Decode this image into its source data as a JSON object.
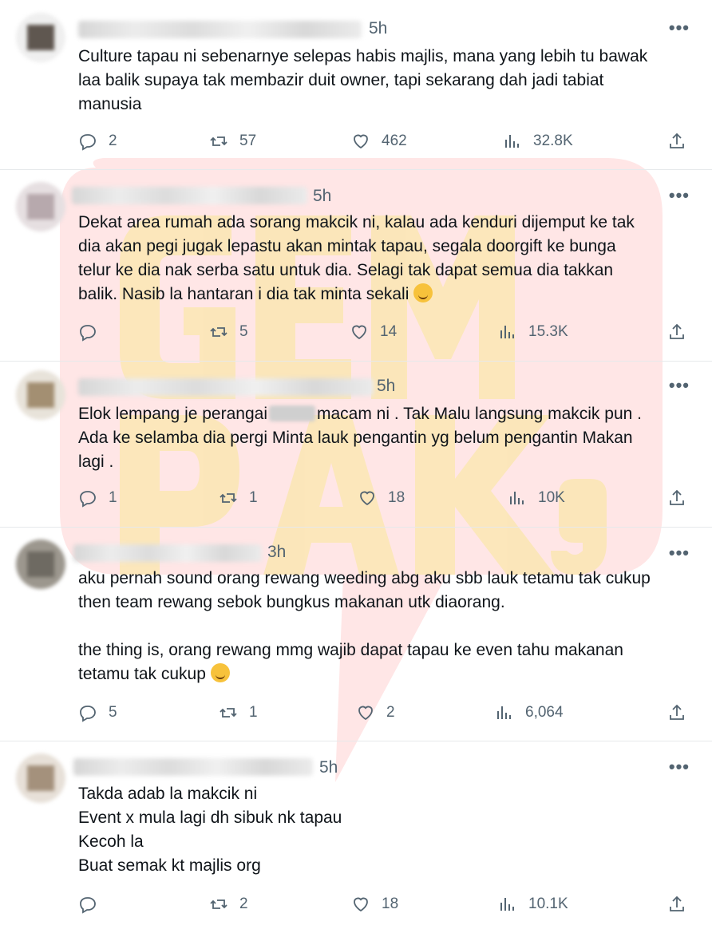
{
  "watermark": {
    "text": "GEMPAK",
    "colors": {
      "back": "#ff5a5a",
      "letters": "#f7ef86"
    }
  },
  "tweets": [
    {
      "avatar_color": "#5f5750",
      "time": "5h",
      "lines": [
        "Culture tapau ni sebenarnye selepas habis majlis, mana yang lebih tu bawak",
        "laa balik supaya tak membazir duit owner, tapi sekarang dah jadi tabiat",
        "manusia"
      ],
      "replies": "2",
      "retweets": "57",
      "likes": "462",
      "views": "32.8K"
    },
    {
      "avatar_color": "#b7a9ad",
      "time": "5h",
      "lines": [
        "Dekat area rumah ada sorang makcik ni, kalau ada kenduri dijemput ke tak",
        "dia akan pegi jugak lepastu akan mintak tapau, segala doorgift ke bunga",
        "telur ke dia nak serba satu untuk dia. Selagi tak dapat semua dia takkan",
        "balik. Nasib la hantaran i dia tak minta sekali"
      ],
      "emoji": "sweat-smile-emoji",
      "replies": "",
      "retweets": "5",
      "likes": "14",
      "views": "15.3K"
    },
    {
      "avatar_color": "#a38f72",
      "time": "5h",
      "line1_before": "Elok lempang je perangai",
      "line1_after": "macam ni . Tak Malu langsung makcik pun .",
      "lines": [
        "Ada ke selamba dia pergi Minta lauk pengantin yg belum pengantin Makan",
        "lagi ."
      ],
      "replies": "1",
      "retweets": "1",
      "likes": "18",
      "views": "10K"
    },
    {
      "avatar_color": "#6e6a62",
      "time": "3h",
      "lines": [
        "aku pernah sound orang rewang weeding abg aku sbb lauk tetamu tak cukup",
        "then team rewang sebok bungkus makanan utk diaorang."
      ],
      "lines2": [
        "the thing is, orang rewang mmg wajib dapat tapau ke even tahu makanan",
        "tetamu tak cukup"
      ],
      "emoji": "laugh-cry-emoji",
      "replies": "5",
      "retweets": "1",
      "likes": "2",
      "views": "6,064"
    },
    {
      "avatar_color": "#a4917c",
      "time": "5h",
      "lines": [
        "Takda adab la makcik ni",
        "Event x mula lagi dh sibuk nk tapau",
        "Kecoh la",
        "Buat semak kt majlis org"
      ],
      "replies": "",
      "retweets": "2",
      "likes": "18",
      "views": "10.1K"
    }
  ]
}
